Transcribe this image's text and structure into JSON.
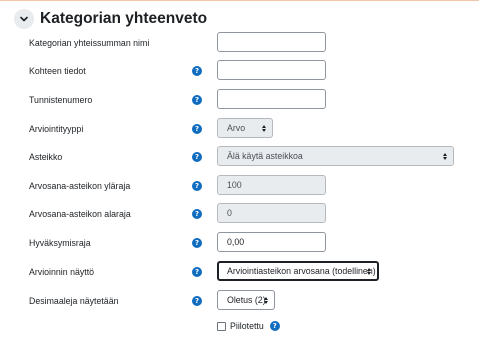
{
  "section": {
    "title": "Kategorian yhteenveto"
  },
  "fields": {
    "name": {
      "label": "Kategorian yhteissumman nimi",
      "value": ""
    },
    "info": {
      "label": "Kohteen tiedot",
      "value": ""
    },
    "idnumber": {
      "label": "Tunnistenumero",
      "value": ""
    },
    "gradetype": {
      "label": "Arviointityyppi",
      "value": "Arvo"
    },
    "scale": {
      "label": "Asteikko",
      "value": "Älä käytä asteikkoa"
    },
    "grademax": {
      "label": "Arvosana-asteikon yläraja",
      "value": "100"
    },
    "grademin": {
      "label": "Arvosana-asteikon alaraja",
      "value": "0"
    },
    "gradepass": {
      "label": "Hyväksymisraja",
      "value": "0,00"
    },
    "display": {
      "label": "Arvioinnin näyttö",
      "value": "Arviointiasteikon arvosana (todellinen)"
    },
    "decimals": {
      "label": "Desimaaleja näytetään",
      "value": "Oletus (2)"
    }
  },
  "hidden": {
    "label": "Piilotettu",
    "checked": false
  },
  "help_icon_glyph": "?",
  "colors": {
    "help_icon": "#0f6cbf",
    "field_border": "#8f959e",
    "disabled_bg": "#e9ecef"
  }
}
